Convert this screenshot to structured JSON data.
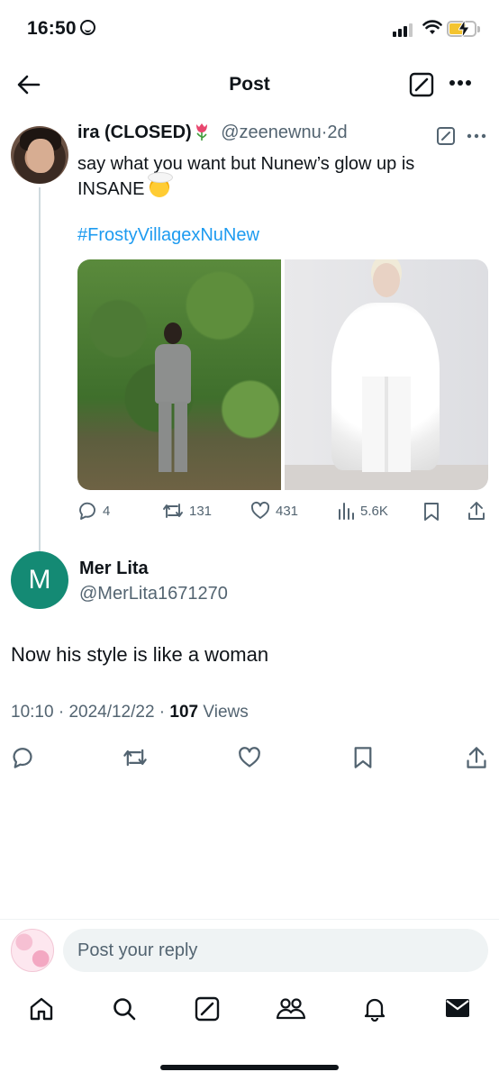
{
  "status_bar": {
    "time": "16:50"
  },
  "header": {
    "title": "Post"
  },
  "parent_tweet": {
    "name": "ira (CLOSED)",
    "handle": "@zeenewnu",
    "separator": "·",
    "age": "2d",
    "text": "say what you want but Nunew’s glow up is INSANE",
    "hashtag": "#FrostyVillagexNuNew",
    "stats": {
      "replies": "4",
      "reposts": "131",
      "likes": "431",
      "views": "5.6K"
    }
  },
  "main_tweet": {
    "avatar_letter": "M",
    "name": "Mer Lita",
    "handle": "@MerLita1671270",
    "text": "Now his style is like a woman",
    "time": "10:10",
    "date": "2024/12/22",
    "views_count": "107",
    "views_label": "Views"
  },
  "reply_bar": {
    "placeholder": "Post your reply"
  },
  "bottom_nav": {
    "items": [
      "home-icon",
      "search-icon",
      "grok-icon",
      "communities-icon",
      "notifications-icon",
      "messages-icon"
    ]
  },
  "colors": {
    "link": "#1d9bf0",
    "secondary_text": "#536471",
    "avatar_bg": "#148a74"
  }
}
